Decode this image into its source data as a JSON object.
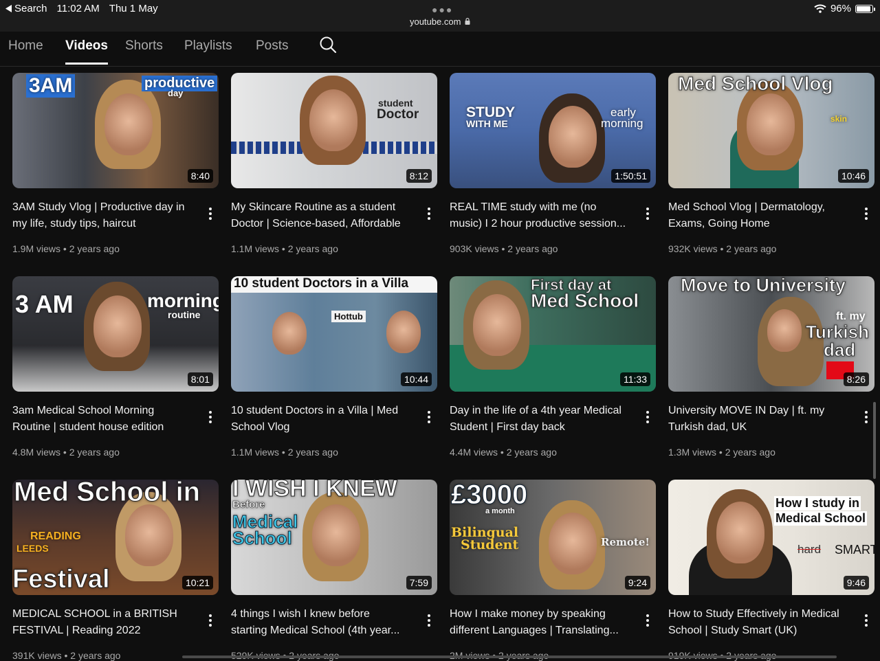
{
  "status": {
    "back_label": "Search",
    "time": "11:02 AM",
    "date": "Thu 1 May",
    "url": "youtube.com",
    "battery": "96%",
    "battery_level": 0.96
  },
  "tabs": [
    {
      "label": "Home",
      "active": false
    },
    {
      "label": "Videos",
      "active": true
    },
    {
      "label": "Shorts",
      "active": false
    },
    {
      "label": "Playlists",
      "active": false
    },
    {
      "label": "Posts",
      "active": false
    }
  ],
  "videos": [
    {
      "title1": "3AM Study Vlog | Productive day in",
      "title2": "my life, study tips, haircut",
      "views": "1.9M views",
      "age": "2 years ago",
      "duration": "8:40",
      "thumb_texts": [
        "3AM",
        "productive",
        "day"
      ]
    },
    {
      "title1": "My Skincare Routine as a student",
      "title2": "Doctor | Science-based, Affordable",
      "views": "1.1M views",
      "age": "2 years ago",
      "duration": "8:12",
      "thumb_texts": [
        "student",
        "Doctor"
      ]
    },
    {
      "title1": "REAL TIME study with me (no",
      "title2": "music) I 2 hour productive session...",
      "views": "903K views",
      "age": "2 years ago",
      "duration": "1:50:51",
      "thumb_texts": [
        "STUDY",
        "WITH ME",
        "early",
        "morning"
      ]
    },
    {
      "title1": "Med School Vlog | Dermatology,",
      "title2": "Exams, Going Home",
      "views": "932K views",
      "age": "2 years ago",
      "duration": "10:46",
      "thumb_texts": [
        "Med School Vlog",
        "skin"
      ]
    },
    {
      "title1": "3am Medical School Morning",
      "title2": "Routine | student house edition",
      "views": "4.8M views",
      "age": "2 years ago",
      "duration": "8:01",
      "thumb_texts": [
        "3 AM",
        "morning",
        "routine"
      ]
    },
    {
      "title1": "10 student Doctors in a Villa | Med",
      "title2": "School Vlog",
      "views": "1.1M views",
      "age": "2 years ago",
      "duration": "10:44",
      "thumb_texts": [
        "10 student Doctors in a Villa",
        "Hottub"
      ]
    },
    {
      "title1": "Day in the life of a 4th year Medical",
      "title2": "Student | First day back",
      "views": "4.4M views",
      "age": "2 years ago",
      "duration": "11:33",
      "thumb_texts": [
        "First day at",
        "Med School"
      ]
    },
    {
      "title1": "University MOVE IN Day | ft. my",
      "title2": "Turkish dad, UK",
      "views": "1.3M views",
      "age": "2 years ago",
      "duration": "8:26",
      "thumb_texts": [
        "Move to University",
        "ft. my",
        "Turkish",
        "dad"
      ]
    },
    {
      "title1": "MEDICAL SCHOOL in a BRITISH",
      "title2": "FESTIVAL | Reading 2022",
      "views": "391K views",
      "age": "2 years ago",
      "duration": "10:21",
      "thumb_texts": [
        "Med School in",
        "READING",
        "LEEDS",
        "Festival"
      ]
    },
    {
      "title1": "4 things I wish I knew before",
      "title2": "starting Medical School (4th year...",
      "views": "529K views",
      "age": "2 years ago",
      "duration": "7:59",
      "thumb_texts": [
        "I WISH I KNEW",
        "Before",
        "Medical",
        "School"
      ]
    },
    {
      "title1": "How I make money by speaking",
      "title2": "different Languages | Translating...",
      "views": "2M views",
      "age": "2 years ago",
      "duration": "9:24",
      "thumb_texts": [
        "£3000",
        "a month",
        "Bilingual",
        "Student",
        "Remote!"
      ]
    },
    {
      "title1": "How to Study Effectively in Medical",
      "title2": "School | Study Smart (UK)",
      "views": "919K views",
      "age": "2 years ago",
      "duration": "9:46",
      "thumb_texts": [
        "How I study in",
        "Medical School",
        "hard",
        "SMART"
      ]
    }
  ]
}
